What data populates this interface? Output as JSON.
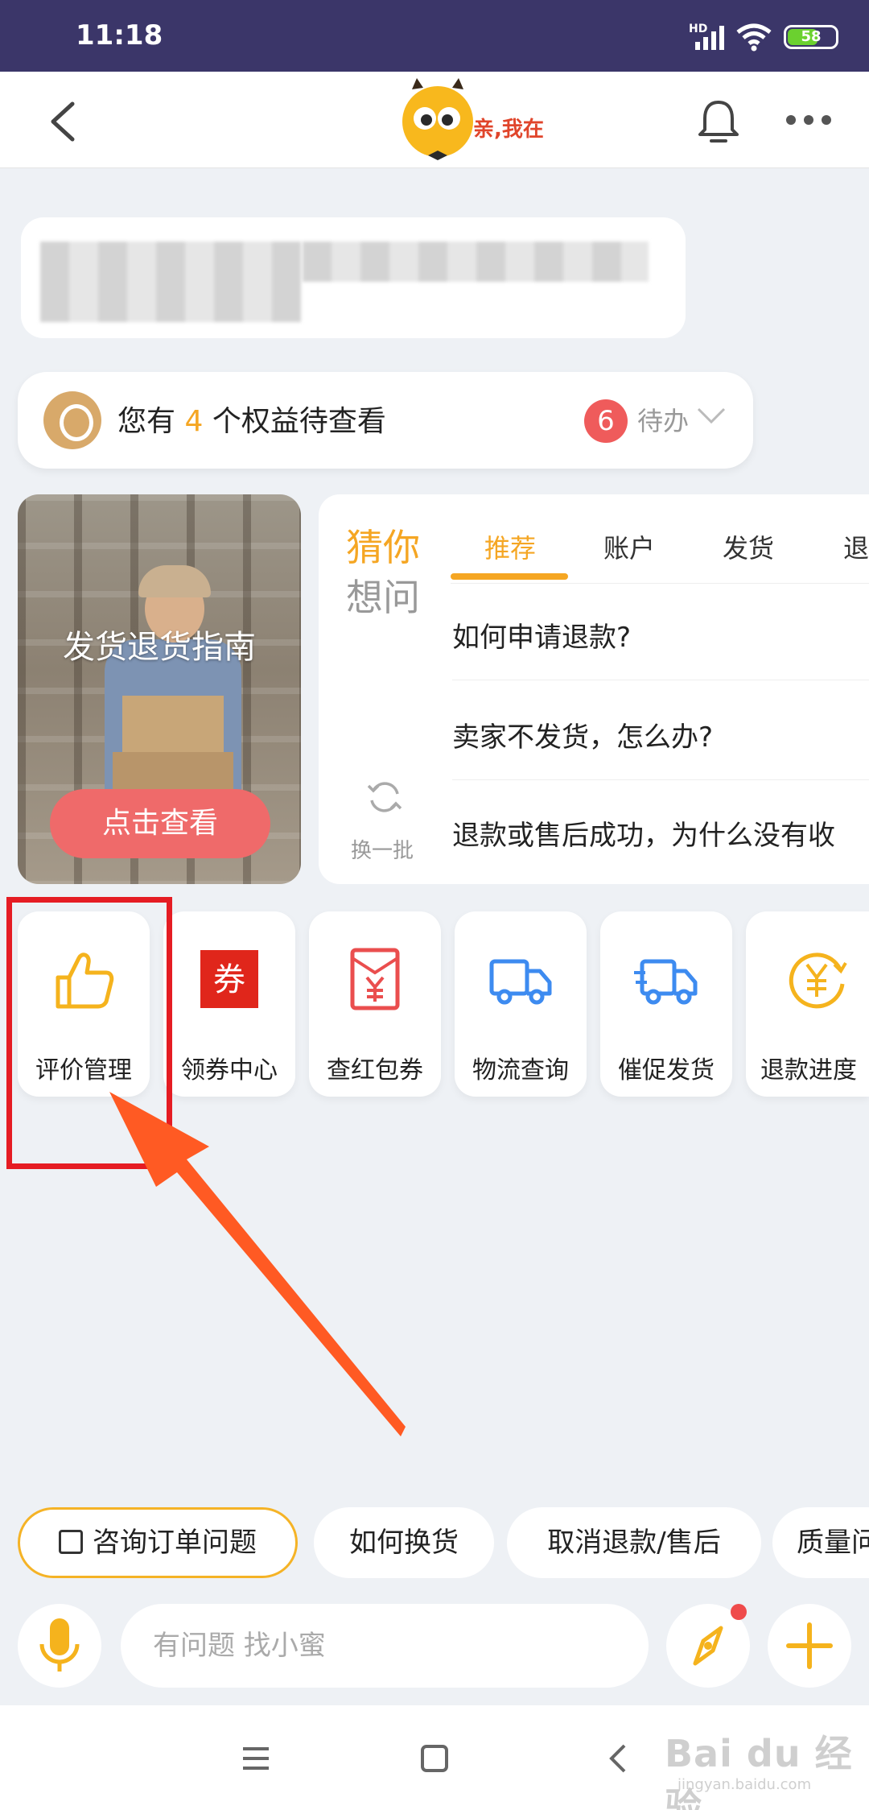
{
  "status_bar": {
    "time": "11:18",
    "network": "HD",
    "battery": "58"
  },
  "header": {
    "logo_text": "亲,我在"
  },
  "benefit": {
    "prefix": "您有",
    "count": "4",
    "suffix": "个权益待查看",
    "badge": "6",
    "todo_label": "待办"
  },
  "guide_card": {
    "title": "发货退货指南",
    "button": "点击查看"
  },
  "faq": {
    "heading_top": "猜你",
    "heading_bottom": "想问",
    "tabs": [
      {
        "label": "推荐",
        "active": true
      },
      {
        "label": "账户",
        "active": false
      },
      {
        "label": "发货",
        "active": false
      },
      {
        "label": "退",
        "active": false
      }
    ],
    "questions": [
      "如何申请退款?",
      "卖家不发货，怎么办?",
      "退款或售后成功，为什么没有收"
    ],
    "refresh_label": "换一批"
  },
  "quick_actions": [
    {
      "label": "评价管理",
      "icon": "thumbs-up-icon"
    },
    {
      "label": "领券中心",
      "icon": "coupon-icon",
      "icon_text": "券"
    },
    {
      "label": "查红包券",
      "icon": "red-packet-icon"
    },
    {
      "label": "物流查询",
      "icon": "truck-icon"
    },
    {
      "label": "催促发货",
      "icon": "fast-truck-icon"
    },
    {
      "label": "退款进度",
      "icon": "yuan-refresh-icon"
    }
  ],
  "chips": [
    "咨询订单问题",
    "如何换货",
    "取消退款/售后",
    "质量问"
  ],
  "input": {
    "placeholder": "有问题 找小蜜"
  },
  "watermark": {
    "line1": "Bai du 经验",
    "line2": "jingyan.baidu.com"
  },
  "colors": {
    "accent": "#f5a623",
    "status_bar": "#3b3669",
    "highlight": "#e51c23",
    "arrow": "#ff5a23"
  }
}
